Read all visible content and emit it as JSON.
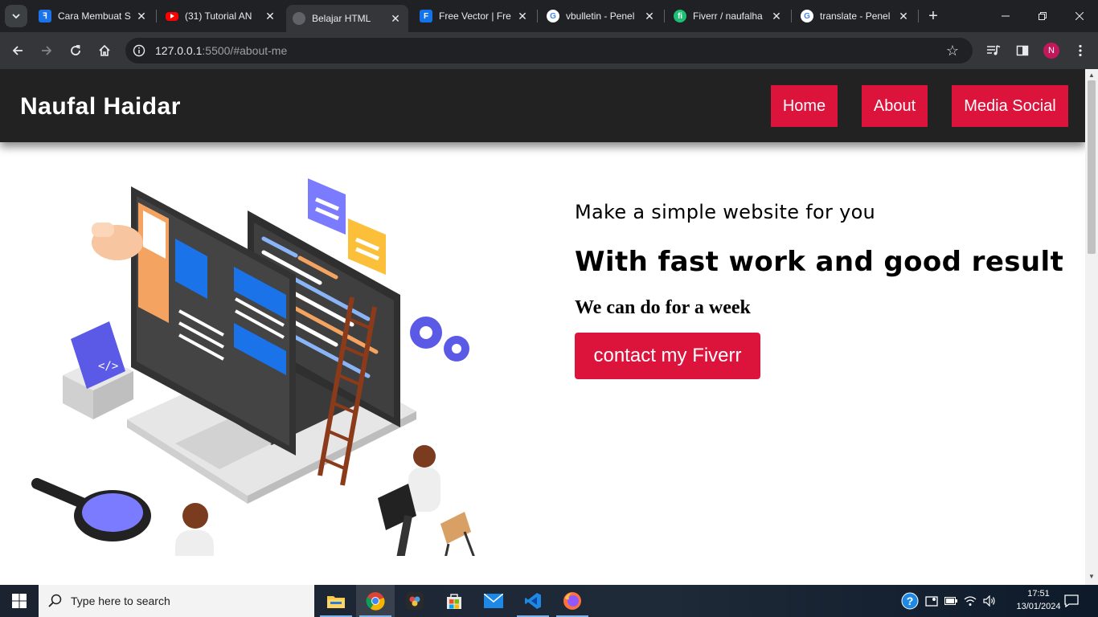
{
  "browser": {
    "tabs": [
      {
        "title": "Cara Membuat S",
        "favicon": "blog-icon",
        "color": "#1a73e8",
        "active": false
      },
      {
        "title": "(31) Tutorial AN",
        "favicon": "youtube-icon",
        "color": "#ff0000",
        "active": false
      },
      {
        "title": "Belajar HTML",
        "favicon": "globe-icon",
        "color": "#5f6368",
        "active": true
      },
      {
        "title": "Free Vector | Fre",
        "favicon": "freepik-icon",
        "color": "#1273eb",
        "active": false
      },
      {
        "title": "vbulletin - Penel",
        "favicon": "google-icon",
        "color": "#ffffff",
        "active": false
      },
      {
        "title": "Fiverr / naufalha",
        "favicon": "fiverr-icon",
        "color": "#1dbf73",
        "active": false
      },
      {
        "title": "translate - Penel",
        "favicon": "google-icon",
        "color": "#ffffff",
        "active": false
      }
    ],
    "url_host": "127.0.0.1",
    "url_rest": ":5500/#about-me",
    "profile_initial": "N"
  },
  "site": {
    "brand": "Naufal Haidar",
    "nav": [
      {
        "label": "Home"
      },
      {
        "label": "About"
      },
      {
        "label": "Media Social"
      }
    ],
    "hero": {
      "subtitle": "Make a simple website for you",
      "headline": "With fast work and good result",
      "tagline": "We can do for a week",
      "cta": "contact my Fiverr"
    },
    "colors": {
      "accent": "#dc143c",
      "header_bg": "#222222"
    }
  },
  "taskbar": {
    "search_placeholder": "Type here to search",
    "time": "17:51",
    "date": "13/01/2024",
    "apps": [
      "file-explorer-icon",
      "chrome-icon",
      "davinci-resolve-icon",
      "microsoft-store-icon",
      "mail-icon",
      "vscode-icon",
      "firefox-icon"
    ]
  }
}
